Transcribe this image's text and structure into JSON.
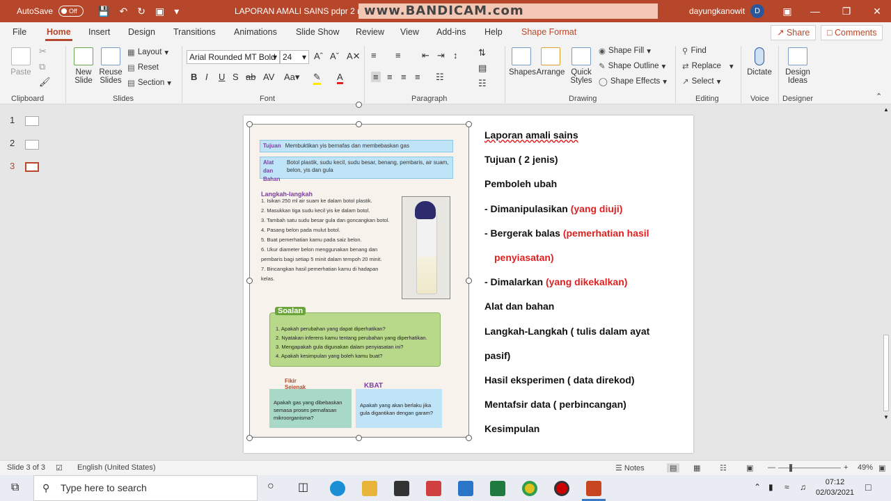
{
  "titlebar": {
    "autosave_label": "AutoSave",
    "autosave_state": "Off",
    "doc_title": "LAPORAN AMALI SAINS pdpr 2 mac",
    "watermark": "www.BANDICAM.com",
    "user_name": "dayungkanowit",
    "user_initial": "D"
  },
  "menu": {
    "tabs": [
      "File",
      "Home",
      "Insert",
      "Design",
      "Transitions",
      "Animations",
      "Slide Show",
      "Review",
      "View",
      "Add-ins",
      "Help",
      "Shape Format"
    ],
    "active": "Home",
    "share": "Share",
    "comments": "Comments"
  },
  "ribbon": {
    "clipboard": {
      "paste": "Paste",
      "label": "Clipboard"
    },
    "slides": {
      "new_slide_1": "New",
      "new_slide_2": "Slide",
      "reuse_1": "Reuse",
      "reuse_2": "Slides",
      "layout": "Layout",
      "reset": "Reset",
      "section": "Section",
      "label": "Slides"
    },
    "font": {
      "name": "Arial Rounded MT Bold",
      "size": "24",
      "label": "Font"
    },
    "paragraph": {
      "label": "Paragraph"
    },
    "drawing": {
      "shapes": "Shapes",
      "arrange": "Arrange",
      "quick_styles_1": "Quick",
      "quick_styles_2": "Styles",
      "shape_fill": "Shape Fill",
      "shape_outline": "Shape Outline",
      "shape_effects": "Shape Effects",
      "label": "Drawing"
    },
    "editing": {
      "find": "Find",
      "replace": "Replace",
      "select": "Select",
      "label": "Editing"
    },
    "voice": {
      "dictate": "Dictate",
      "label": "Voice"
    },
    "designer": {
      "ideas_1": "Design",
      "ideas_2": "Ideas",
      "label": "Designer"
    }
  },
  "thumbnails": [
    {
      "num": "1",
      "active": false
    },
    {
      "num": "2",
      "active": false
    },
    {
      "num": "3",
      "active": true
    }
  ],
  "scan": {
    "tujuan_label": "Tujuan",
    "tujuan_text": "Membuktikan yis bernafas dan membebaskan gas",
    "alat_label_1": "Alat dan",
    "alat_label_2": "Bahan",
    "alat_text": "Botol plastik, sudu kecil, sudu besar, benang, pembaris, air suam, belon, yis dan gula",
    "langkah_title": "Langkah-langkah",
    "steps": [
      "1.  Isikan 250 ml air suam ke dalam botol plastik.",
      "2.  Masukkan tiga sudu kecil yis ke dalam botol.",
      "3.  Tambah satu sudu besar gula dan goncangkan botol.",
      "4.  Pasang belon pada mulut botol.",
      "5.  Buat pemerhatian kamu pada saiz belon.",
      "6.  Ukur diameter belon menggunakan benang dan",
      "     pembaris bagi setiap 5 minit dalam tempoh 20 minit.",
      "7.  Bincangkan hasil pemerhatian kamu di hadapan",
      "     kelas."
    ],
    "soalan_title": "Soalan",
    "soalan_items": [
      "1.  Apakah perubahan yang dapat diperhatikan?",
      "2.  Nyatakan inferens kamu tentang perubahan yang diperhatikan.",
      "3.  Mengapakah gula digunakan dalam penyiasatan ini?",
      "4.  Apakah kesimpulan yang boleh kamu buat?"
    ],
    "fikir_1": "Fikir",
    "fikir_2": "Sejenak",
    "fikir_text": "Apakah gas yang dibebaskan semasa proses pernafasan mikroorganisma?",
    "kbat_title": "KBAT",
    "kbat_text": "Apakah yang akan berlaku jika gula digantikan dengan garam?"
  },
  "slide_text": {
    "l1": "Laporan amali sains",
    "l2": "Tujuan ( 2 jenis)",
    "l3": "Pemboleh ubah",
    "l4a": "-  Dimanipulasikan ",
    "l4b": "(yang diuji)",
    "l5a": "-  Bergerak balas ",
    "l5b": "(pemerhatian hasil",
    "l6": "penyiasatan)",
    "l7a": "-  Dimalarkan ",
    "l7b": "(yang dikekalkan)",
    "l8": "Alat dan bahan",
    "l9": "Langkah-Langkah ( tulis dalam ayat",
    "l10": "pasif)",
    "l11": "Hasil eksperimen ( data direkod)",
    "l12": "Mentafsir data ( perbincangan)",
    "l13": "Kesimpulan"
  },
  "status": {
    "slide_count": "Slide 3 of 3",
    "language": "English (United States)",
    "notes": "Notes",
    "zoom": "49%"
  },
  "taskbar": {
    "search_placeholder": "Type here to search",
    "time": "07:12",
    "date": "02/03/2021"
  }
}
